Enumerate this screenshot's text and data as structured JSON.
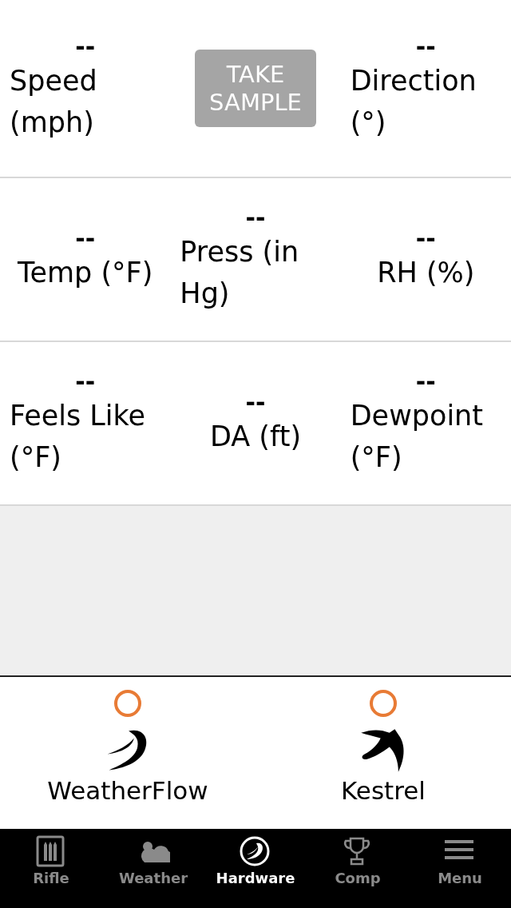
{
  "readings": [
    {
      "kind": "reading",
      "value": "--",
      "label": "Speed (mph)"
    },
    {
      "kind": "button",
      "label": "TAKE SAMPLE"
    },
    {
      "kind": "reading",
      "value": "--",
      "label": "Direction (°)"
    },
    {
      "kind": "reading",
      "value": "--",
      "label": "Temp (°F)"
    },
    {
      "kind": "reading",
      "value": "--",
      "label": "Press (in Hg)"
    },
    {
      "kind": "reading",
      "value": "--",
      "label": "RH (%)"
    },
    {
      "kind": "reading",
      "value": "--",
      "label": "Feels Like (°F)"
    },
    {
      "kind": "reading",
      "value": "--",
      "label": "DA (ft)"
    },
    {
      "kind": "reading",
      "value": "--",
      "label": "Dewpoint (°F)"
    }
  ],
  "devices": [
    {
      "name": "WeatherFlow",
      "connected": false
    },
    {
      "name": "Kestrel",
      "connected": false
    }
  ],
  "tabs": [
    {
      "label": "Rifle",
      "selected": false
    },
    {
      "label": "Weather",
      "selected": false
    },
    {
      "label": "Hardware",
      "selected": true
    },
    {
      "label": "Comp",
      "selected": false
    },
    {
      "label": "Menu",
      "selected": false
    }
  ]
}
